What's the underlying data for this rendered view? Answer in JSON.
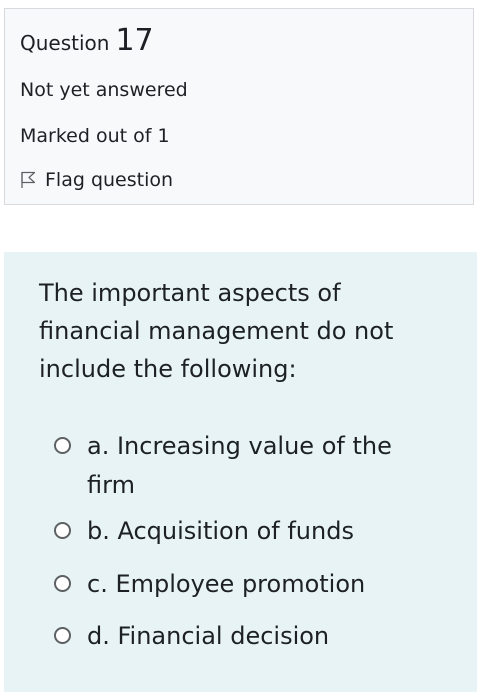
{
  "question_info": {
    "label": "Question",
    "number": "17",
    "state": "Not yet answered",
    "grade": "Marked out of 1",
    "flag_label": "Flag question",
    "flag_icon": "flag-outline-icon"
  },
  "question": {
    "text": "The important aspects of financial management do not include the following:",
    "answers": [
      {
        "label": "a. Increasing value of the firm",
        "selected": false
      },
      {
        "label": "b. Acquisition of funds",
        "selected": false
      },
      {
        "label": "c. Employee promotion",
        "selected": false
      },
      {
        "label": "d. Financial decision",
        "selected": false
      }
    ]
  },
  "colors": {
    "info_background": "#f8f9fa",
    "info_border": "#d7d9dc",
    "content_background": "#e7f3f5",
    "text": "#1d2125"
  }
}
